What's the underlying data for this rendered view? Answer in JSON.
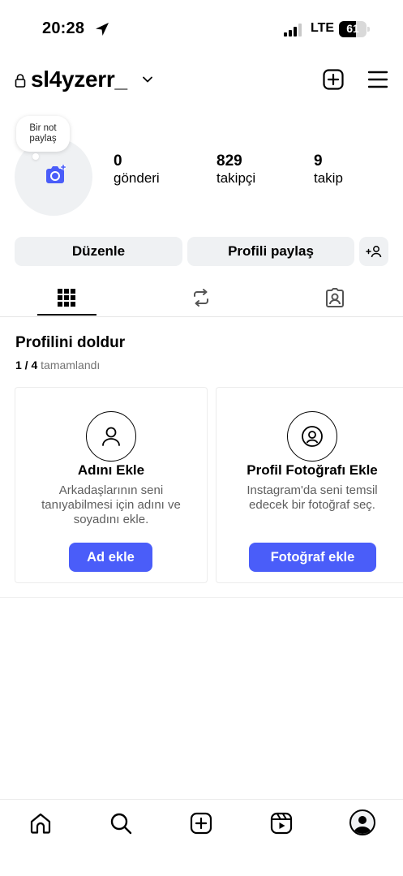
{
  "status_bar": {
    "time": "20:28",
    "network": "LTE",
    "battery": "61",
    "battery_fraction": 0.61
  },
  "header": {
    "username": "sl4yzerr_",
    "icons": [
      "lock-icon",
      "chevron-down-icon",
      "new-post-icon",
      "menu-icon"
    ]
  },
  "note": {
    "line1": "Bir not",
    "line2": "paylaş"
  },
  "stats": [
    {
      "value": "0",
      "label": "gönderi"
    },
    {
      "value": "829",
      "label": "takipçi"
    },
    {
      "value": "9",
      "label": "takip"
    }
  ],
  "actions": {
    "edit_label": "Düzenle",
    "share_label": "Profili paylaş"
  },
  "tabs": [
    "grid-icon",
    "reels-icon",
    "tagged-icon"
  ],
  "complete_profile": {
    "title": "Profilini doldur",
    "progress": "1 / 4",
    "progress_suffix": "tamamlandı",
    "cards": [
      {
        "title": "Adını Ekle",
        "desc1": "Arkadaşlarının seni",
        "desc2": "tanıyabilmesi için adını ve",
        "desc3": "soyadını ekle.",
        "button": "Ad ekle"
      },
      {
        "title": "Profil Fotoğrafı Ekle",
        "desc1": "Instagram'da seni temsil",
        "desc2": "edecek bir fotoğraf seç.",
        "button": "Fotoğraf ekle"
      }
    ]
  },
  "bottom_nav": [
    "home-icon",
    "search-icon",
    "create-icon",
    "reels-icon",
    "profile-icon"
  ],
  "colors": {
    "accent": "#4a5df9",
    "button_bg": "#eff1f3"
  }
}
